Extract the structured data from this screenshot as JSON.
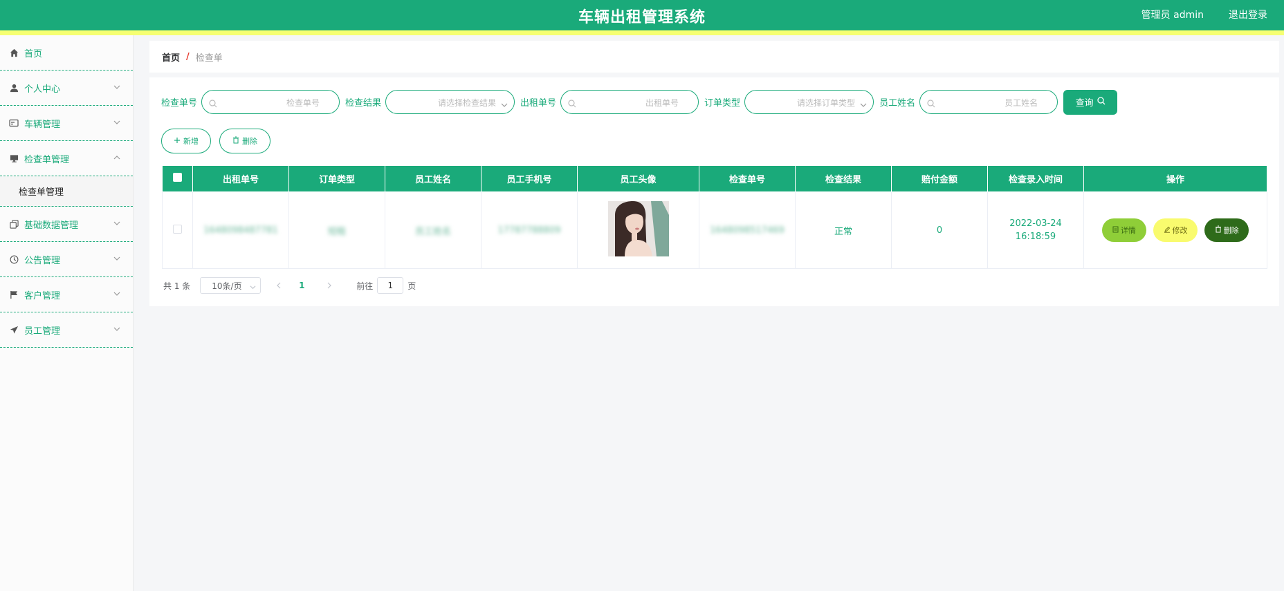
{
  "header": {
    "title": "车辆出租管理系统",
    "user_label": "管理员 admin",
    "logout_label": "退出登录"
  },
  "sidebar": {
    "items": [
      {
        "label": "首页",
        "icon": "home-icon",
        "expandable": false
      },
      {
        "label": "个人中心",
        "icon": "user-icon",
        "expandable": true
      },
      {
        "label": "车辆管理",
        "icon": "card-icon",
        "expandable": true
      },
      {
        "label": "检查单管理",
        "icon": "monitor-icon",
        "expandable": true,
        "expanded": true,
        "children": [
          {
            "label": "检查单管理"
          }
        ]
      },
      {
        "label": "基础数据管理",
        "icon": "copy-icon",
        "expandable": true
      },
      {
        "label": "公告管理",
        "icon": "clock-icon",
        "expandable": true
      },
      {
        "label": "客户管理",
        "icon": "flag-icon",
        "expandable": true
      },
      {
        "label": "员工管理",
        "icon": "send-icon",
        "expandable": true
      }
    ]
  },
  "breadcrumb": {
    "home": "首页",
    "separator": "/",
    "current": "检查单"
  },
  "filters": {
    "check_no": {
      "label": "检查单号",
      "placeholder": "检查单号"
    },
    "check_result": {
      "label": "检查结果",
      "placeholder": "请选择检查结果"
    },
    "rent_no": {
      "label": "出租单号",
      "placeholder": "出租单号"
    },
    "order_type": {
      "label": "订单类型",
      "placeholder": "请选择订单类型"
    },
    "staff_name": {
      "label": "员工姓名",
      "placeholder": "员工姓名"
    },
    "query_label": "查询"
  },
  "actions": {
    "add_label": "新增",
    "delete_label": "删除"
  },
  "table": {
    "headers": [
      "出租单号",
      "订单类型",
      "员工姓名",
      "员工手机号",
      "员工头像",
      "检查单号",
      "检查结果",
      "赔付金额",
      "检查录入时间",
      "操作"
    ],
    "rows": [
      {
        "rent_no": "1648098487781",
        "order_type": "短租",
        "staff_name": "员工姓名",
        "staff_phone": "17787788809",
        "check_no": "1648098517469",
        "check_result": "正常",
        "amount": "0",
        "time": "2022-03-24 16:18:59",
        "ops": {
          "detail": "详情",
          "edit": "修改",
          "delete": "删除"
        }
      }
    ]
  },
  "pagination": {
    "total_text": "共 1 条",
    "page_size": "10条/页",
    "current_page": "1",
    "goto_prefix": "前往",
    "goto_value": "1",
    "goto_suffix": "页"
  },
  "colors": {
    "primary": "#1aaa7a",
    "accent_bar": "#f6ff72",
    "detail_btn": "#8fce38",
    "edit_btn": "#f9fb6e",
    "delete_btn": "#2e6b1a"
  }
}
